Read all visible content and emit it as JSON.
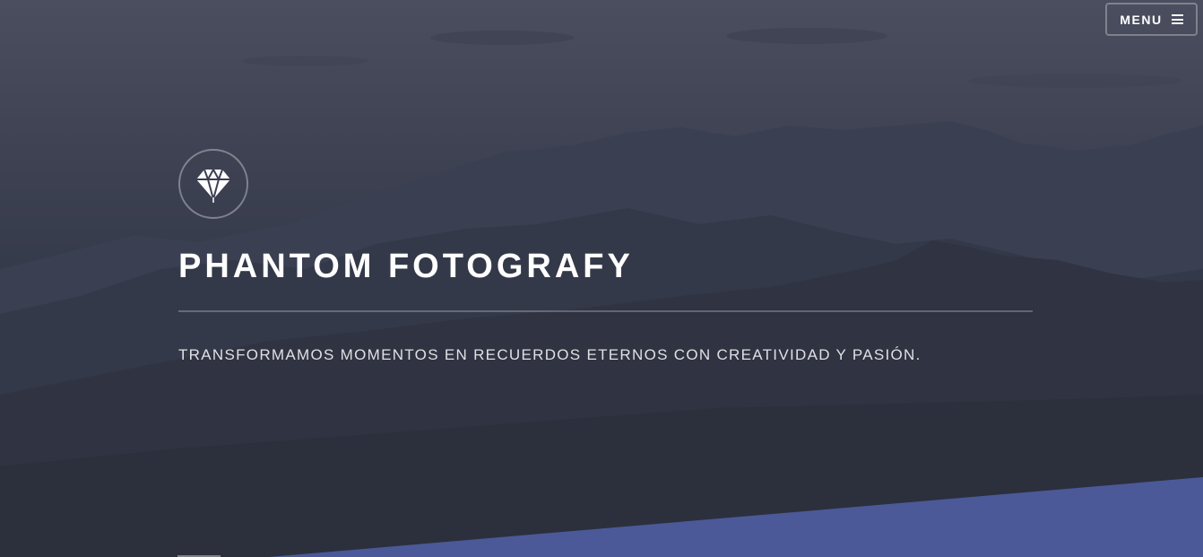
{
  "header": {
    "menu_label": "MENU"
  },
  "banner": {
    "title": "PHANTOM FOTOGRAFY",
    "tagline": "TRANSFORMAMOS MOMENTOS EN RECUERDOS ETERNOS CON CREATIVIDAD Y PASIÓN.",
    "logo_icon": "diamond-icon"
  },
  "colors": {
    "accent": "#4b5998",
    "background": "#2e3140",
    "text": "#ffffff"
  }
}
